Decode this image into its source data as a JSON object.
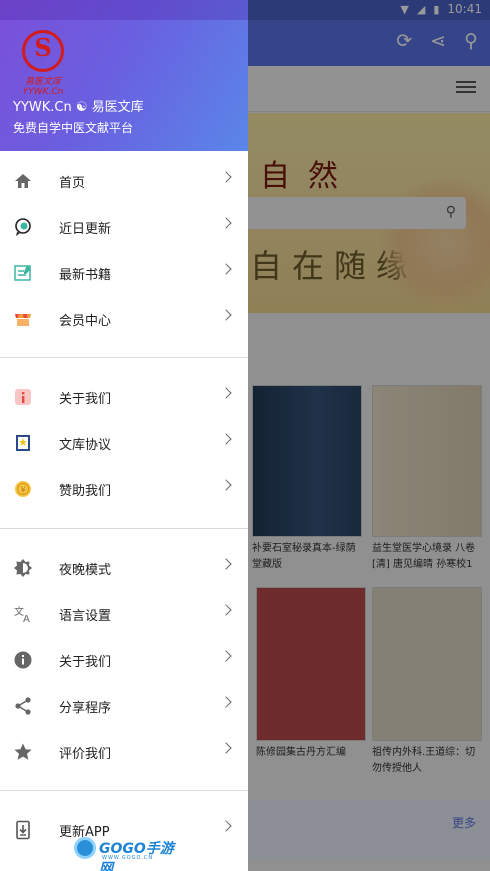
{
  "status_bar": {
    "time": "10:41"
  },
  "drawer_header": {
    "logo_text": "易医文库 YYWK.Cn",
    "title": "YYWK.Cn ☯ 易医文库",
    "subtitle": "免费自学中医文献平台"
  },
  "menu_group_1": [
    {
      "label": "首页",
      "icon": "home-icon"
    },
    {
      "label": "近日更新",
      "icon": "chat-update-icon"
    },
    {
      "label": "最新书籍",
      "icon": "edit-list-icon"
    },
    {
      "label": "会员中心",
      "icon": "store-icon"
    }
  ],
  "menu_group_2": [
    {
      "label": "关于我们",
      "icon": "info-badge-icon"
    },
    {
      "label": "文库协议",
      "icon": "agreement-icon"
    },
    {
      "label": "赞助我们",
      "icon": "coin-icon"
    }
  ],
  "menu_group_3": [
    {
      "label": "夜晚模式",
      "icon": "night-mode-icon"
    },
    {
      "label": "语言设置",
      "icon": "translate-icon"
    },
    {
      "label": "关于我们",
      "icon": "info-icon"
    },
    {
      "label": "分享程序",
      "icon": "share-icon"
    },
    {
      "label": "评价我们",
      "icon": "star-icon"
    }
  ],
  "menu_group_4": [
    {
      "label": "更新APP",
      "icon": "download-app-icon"
    }
  ],
  "background": {
    "banner_text_1": "自然",
    "banner_text_2": "自在随缘",
    "books": [
      {
        "caption": "补要石室秘录真本-绿荫堂藏版"
      },
      {
        "caption": "益生堂医学心境录 八卷[清] 唐见编晴 孙寒校1"
      },
      {
        "caption": "陈修园集古丹方汇编"
      },
      {
        "caption": "祖传内外科.王道综：切勿传授他人"
      }
    ],
    "more_label": "更多"
  },
  "watermark": {
    "text": "GOGO手游网",
    "url": "WWW.GOGO.CN"
  },
  "colors": {
    "header_start": "#7b4fd9",
    "header_end": "#5a86e8",
    "app_bar": "#5b74e4",
    "logo_red": "#d21b1b"
  }
}
